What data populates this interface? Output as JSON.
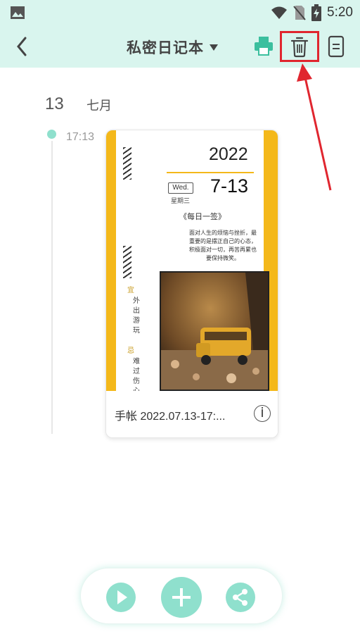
{
  "status_bar": {
    "time": "5:20",
    "icons": [
      "image-icon",
      "wifi-icon",
      "no-sim-icon",
      "battery-charging-icon"
    ]
  },
  "app_bar": {
    "title": "私密日记本",
    "icons": [
      "back-icon",
      "dropdown-caret-icon",
      "print-icon",
      "trash-icon",
      "document-icon"
    ],
    "accent": "#d9f5ee"
  },
  "timeline": {
    "day": "13",
    "month": "七月",
    "entries": [
      {
        "time": "17:13",
        "title": "手帐 2022.07.13-17:...",
        "thumbnail": {
          "year": "2022",
          "date": "7-13",
          "weekday_en": "Wed.",
          "weekday_cn": "星期三",
          "heading": "《每日一签》",
          "quote": "面对人生的烦恼与挫折，最重要的是摆正自己的心态，积极面对一切，再苦再累也要保持微笑。",
          "tag_yi": "宜",
          "yi_text": "外出游玩",
          "tag_ji": "忌",
          "ji_text": "难过伤心"
        }
      }
    ]
  },
  "bottom_bar": {
    "icons": [
      "play-icon",
      "add-icon",
      "share-icon"
    ],
    "button_color": "#8fe0cd"
  },
  "annotation": {
    "highlight_color": "#e0262f"
  }
}
